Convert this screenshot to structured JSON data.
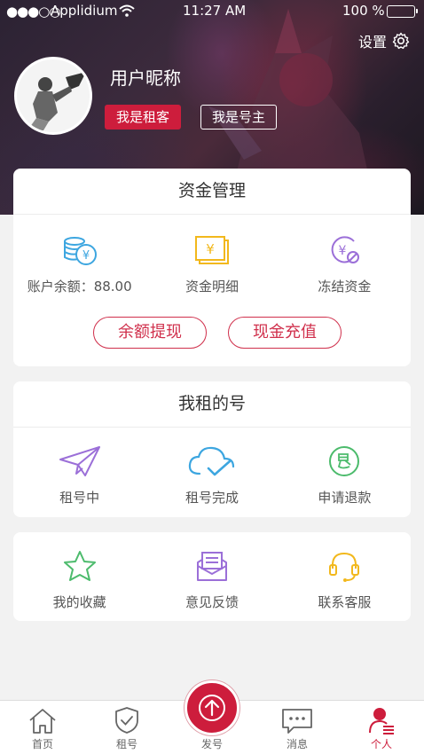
{
  "status_bar": {
    "signal_dots": "●●●○○",
    "carrier": "Applidium",
    "time": "11:27 AM",
    "battery": "100 %",
    "battery_level": 1.0
  },
  "header": {
    "settings_label": "设置",
    "nickname": "用户昵称",
    "role_renter": "我是租客",
    "role_owner": "我是号主"
  },
  "funds": {
    "title": "资金管理",
    "items": [
      {
        "label": "账户余额：88.00",
        "icon": "coins-yen-icon",
        "color": "#3da6e0"
      },
      {
        "label": "资金明细",
        "icon": "yen-bill-icon",
        "color": "#f2b81c"
      },
      {
        "label": "冻结资金",
        "icon": "frozen-yen-icon",
        "color": "#9b6fd8"
      }
    ],
    "withdraw_label": "余额提现",
    "recharge_label": "现金充值"
  },
  "rented": {
    "title": "我租的号",
    "items": [
      {
        "label": "租号中",
        "icon": "paper-plane-icon",
        "color": "#9b6fd8"
      },
      {
        "label": "租号完成",
        "icon": "cloud-check-icon",
        "color": "#3da6e0"
      },
      {
        "label": "申请退款",
        "icon": "refund-icon",
        "color": "#4cbb6c"
      }
    ]
  },
  "more": {
    "items": [
      {
        "label": "我的收藏",
        "icon": "star-icon",
        "color": "#4cbb6c"
      },
      {
        "label": "意见反馈",
        "icon": "mail-feedback-icon",
        "color": "#9b6fd8"
      },
      {
        "label": "联系客服",
        "icon": "headset-icon",
        "color": "#f2b81c"
      }
    ]
  },
  "tabbar": {
    "items": [
      {
        "label": "首页",
        "icon": "home-icon"
      },
      {
        "label": "租号",
        "icon": "shield-check-icon"
      },
      {
        "label": "发号",
        "icon": "upload-arrow-icon"
      },
      {
        "label": "消息",
        "icon": "chat-bubble-icon"
      },
      {
        "label": "个人",
        "icon": "user-profile-icon"
      }
    ],
    "active_label": "个人",
    "accent": "#cd1d3c"
  }
}
